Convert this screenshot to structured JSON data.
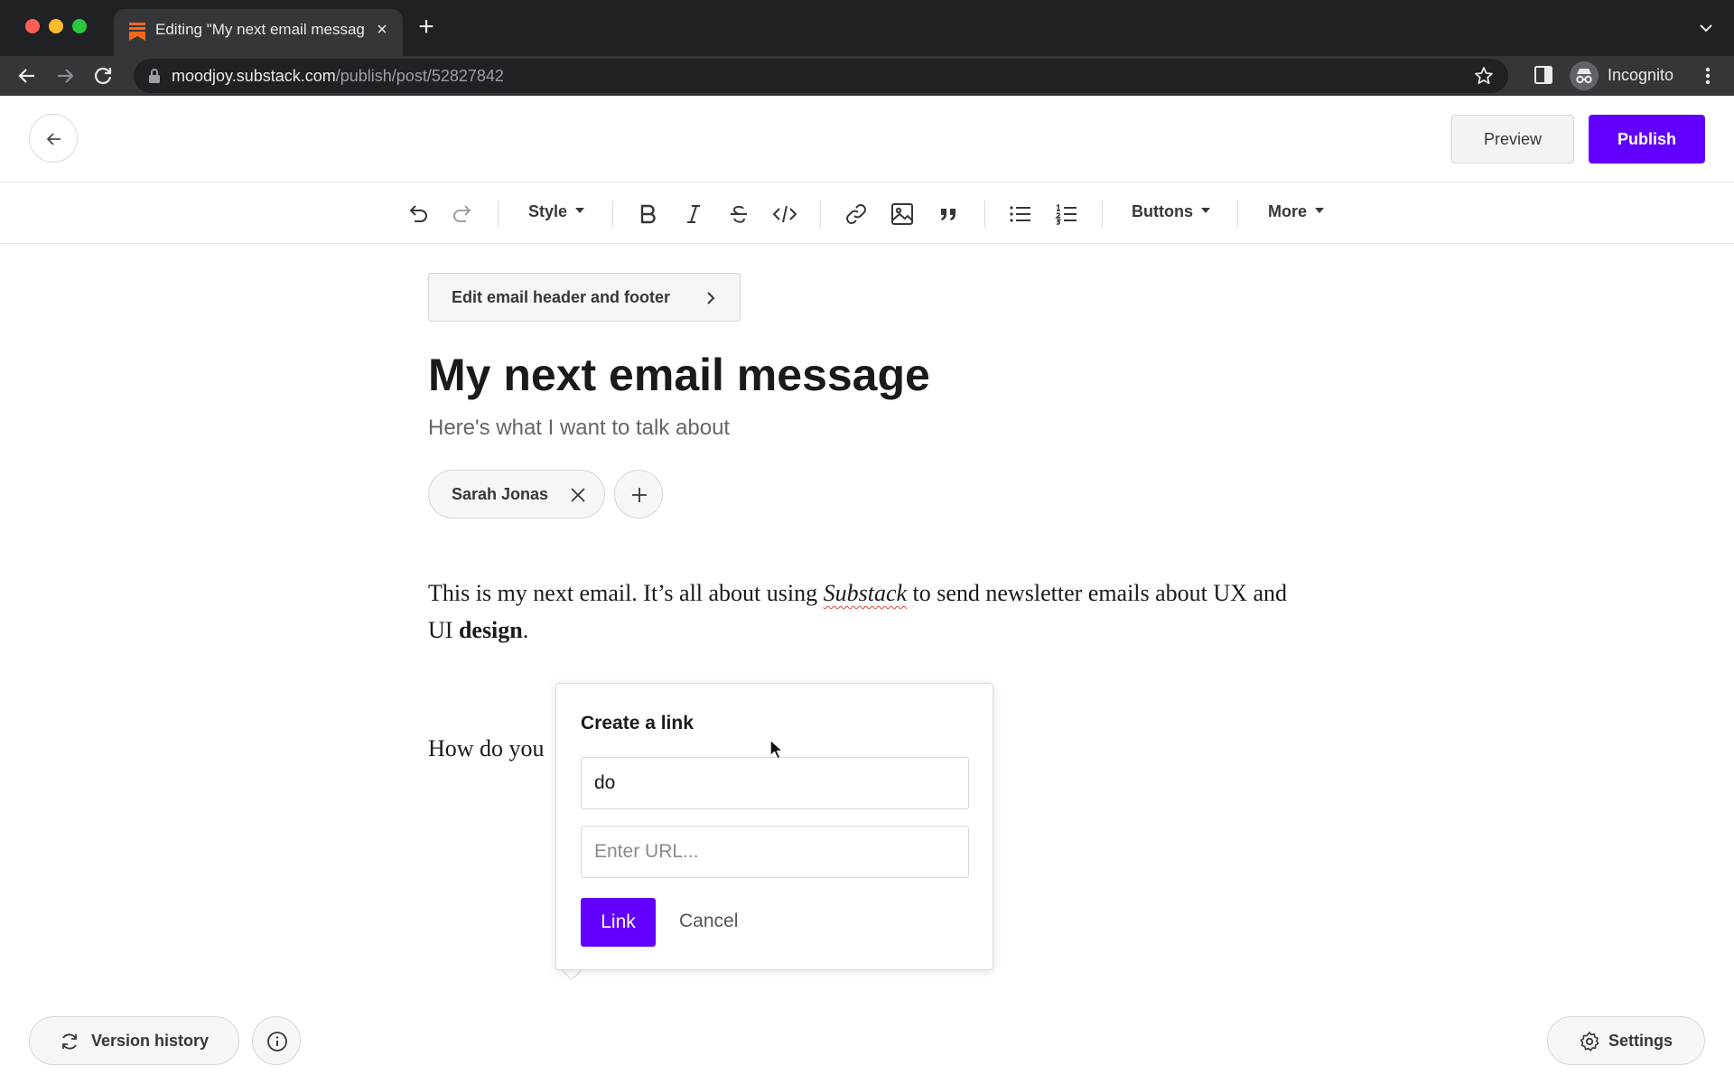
{
  "browser": {
    "tab_title": "Editing \"My next email message\"",
    "url_host": "moodjoy.substack.com",
    "url_path": "/publish/post/52827842",
    "profile_label": "Incognito",
    "icons": {
      "back": "arrow-left-icon",
      "forward": "arrow-right-icon",
      "reload": "reload-icon",
      "lock": "lock-icon",
      "bookmark": "star-icon",
      "side_panel": "side-panel-icon",
      "profile": "incognito-icon",
      "menu": "kebab-icon"
    }
  },
  "header": {
    "preview_label": "Preview",
    "publish_label": "Publish",
    "accent_color": "#6100ff"
  },
  "toolbar": {
    "style_label": "Style",
    "buttons_label": "Buttons",
    "more_label": "More",
    "icons": [
      "undo-icon",
      "redo-icon",
      "bold-icon",
      "italic-icon",
      "strikethrough-icon",
      "code-icon",
      "link-icon",
      "image-icon",
      "quote-icon",
      "bullet-list-icon",
      "numbered-list-icon"
    ]
  },
  "editor": {
    "edit_header_footer_label": "Edit email header and footer",
    "title": "My next email message",
    "subtitle": "Here's what I want to talk about",
    "author_name": "Sarah Jonas",
    "paragraph1": {
      "before": "This is my next email. It’s all about using ",
      "italic_word": "Substack",
      "middle": " to send newsletter emails about UX and UI ",
      "bold_word": "design",
      "after": "."
    },
    "paragraph2": "How do you"
  },
  "link_popover": {
    "heading": "Create a link",
    "text_value": "do",
    "url_placeholder": "Enter URL...",
    "link_button_label": "Link",
    "cancel_label": "Cancel"
  },
  "footer": {
    "version_history_label": "Version history",
    "settings_label": "Settings"
  }
}
